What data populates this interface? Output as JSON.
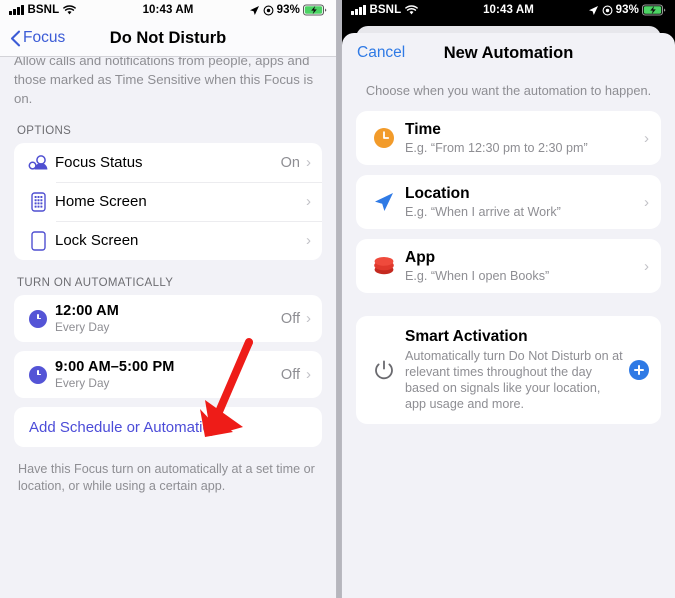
{
  "status_bar": {
    "carrier": "BSNL",
    "time": "10:43 AM",
    "battery_percent": "93%",
    "icons": {
      "signal": "signal-bars-icon",
      "wifi": "wifi-icon",
      "location": "location-arrow-icon",
      "focus": "focus-circle-icon",
      "battery": "battery-charging-icon"
    }
  },
  "left_panel": {
    "nav": {
      "back_label": "Focus",
      "back_icon": "chevron-left-icon",
      "title": "Do Not Disturb"
    },
    "clipped_note": {
      "line1": "Allow calls and notifications from people, apps and",
      "line2": "those marked as Time Sensitive when this Focus is",
      "line3": "on."
    },
    "options": {
      "header": "OPTIONS",
      "rows": [
        {
          "label": "Focus Status",
          "value": "On",
          "icon": "focus-status-icon"
        },
        {
          "label": "Home Screen",
          "value": "",
          "icon": "home-screen-icon"
        },
        {
          "label": "Lock Screen",
          "value": "",
          "icon": "lock-screen-icon"
        }
      ]
    },
    "automatically": {
      "header": "TURN ON AUTOMATICALLY",
      "schedules": [
        {
          "time": "12:00 AM",
          "repeat": "Every Day",
          "state": "Off",
          "icon": "clock-icon"
        },
        {
          "time": "9:00 AM–5:00 PM",
          "repeat": "Every Day",
          "state": "Off",
          "icon": "clock-icon"
        }
      ],
      "add_label": "Add Schedule or Automation",
      "add_icon": "plus-circle-icon",
      "footnote": "Have this Focus turn on automatically at a set time or location, or while using a certain app."
    },
    "annotation": {
      "type": "red-arrow",
      "color": "#ee1c18",
      "points_to": "Add Schedule or Automation"
    }
  },
  "right_panel": {
    "sheet": {
      "cancel_label": "Cancel",
      "title": "New Automation",
      "subtitle": "Choose when you want the automation to happen.",
      "options": [
        {
          "title": "Time",
          "example": "E.g. “From 12:30 pm to 2:30 pm”",
          "icon": "clock-icon",
          "color": "#f29b2a"
        },
        {
          "title": "Location",
          "example": "E.g. “When I arrive at Work”",
          "icon": "location-arrow-icon",
          "color": "#2f7ae5"
        },
        {
          "title": "App",
          "example": "E.g. “When I open Books”",
          "icon": "app-stack-icon",
          "color": "#e0382c"
        }
      ],
      "smart_activation": {
        "title": "Smart Activation",
        "description": "Automatically turn Do Not Disturb on at relevant times throughout the day based on signals like your location, app usage and more.",
        "icon": "power-icon",
        "add_icon": "plus-circle-icon"
      }
    }
  },
  "colors": {
    "indigo": "#5454d6",
    "blue": "#2f7ae5",
    "red_annotation": "#ee1c18",
    "orange": "#f29b2a",
    "app_red": "#e0382c"
  }
}
